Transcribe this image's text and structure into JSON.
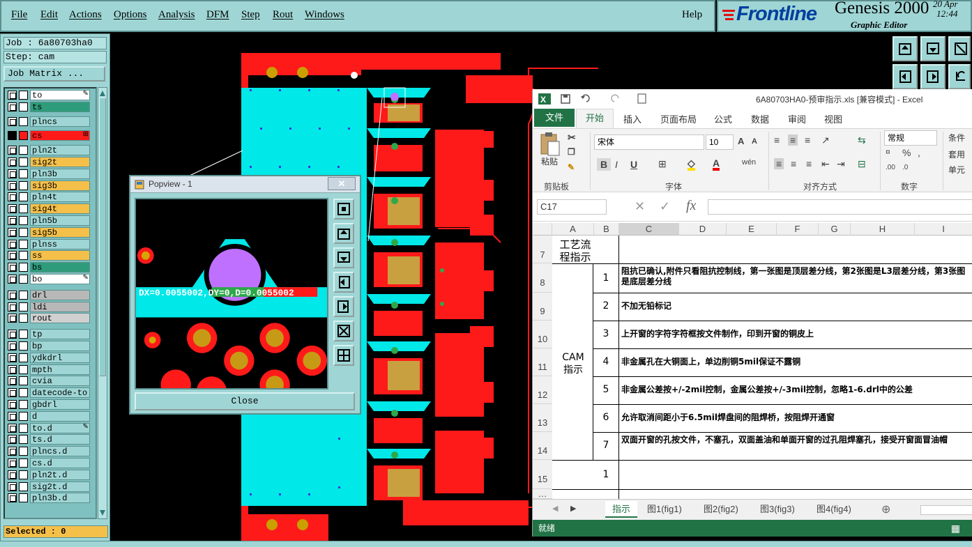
{
  "menu": {
    "items": [
      "File",
      "Edit",
      "Actions",
      "Options",
      "Analysis",
      "DFM",
      "Step",
      "Rout",
      "Windows"
    ],
    "help": "Help"
  },
  "brand": {
    "logo": "Frontline",
    "product": "Genesis 2000",
    "subtitle": "Graphic Editor",
    "date": "20 Apr",
    "time": "12:44"
  },
  "job": {
    "job_line": "Job : 6a80703ha0",
    "step_line": "Step: cam",
    "matrix_button": "Job Matrix ...",
    "selected": "Selected : 0"
  },
  "layers": [
    {
      "name": "to",
      "color": "#ffffff",
      "mark": "pen"
    },
    {
      "name": "ts",
      "color": "#2e9c7a"
    },
    {
      "name": "plncs",
      "color": "#9fd6d5"
    },
    {
      "name": "cs",
      "color": "#ff1a1a",
      "mark": "grid",
      "active": true
    },
    {
      "name": "pln2t",
      "color": "#9fd6d5"
    },
    {
      "name": "sig2t",
      "color": "#f5c04a"
    },
    {
      "name": "pln3b",
      "color": "#9fd6d5"
    },
    {
      "name": "sig3b",
      "color": "#f5c04a"
    },
    {
      "name": "pln4t",
      "color": "#9fd6d5"
    },
    {
      "name": "sig4t",
      "color": "#f5c04a"
    },
    {
      "name": "pln5b",
      "color": "#9fd6d5"
    },
    {
      "name": "sig5b",
      "color": "#f5c04a"
    },
    {
      "name": "plnss",
      "color": "#9fd6d5"
    },
    {
      "name": "ss",
      "color": "#f5c04a"
    },
    {
      "name": "bs",
      "color": "#2e9c7a"
    },
    {
      "name": "bo",
      "color": "#ffffff",
      "mark": "pen"
    },
    {
      "name": "drl",
      "color": "#b8b8b8"
    },
    {
      "name": "ldi",
      "color": "#b8b8b8"
    },
    {
      "name": "rout",
      "color": "#d0d0d0"
    },
    {
      "name": "tp",
      "color": "#9fd6d5"
    },
    {
      "name": "bp",
      "color": "#9fd6d5"
    },
    {
      "name": "ydkdrl",
      "color": "#9fd6d5"
    },
    {
      "name": "mpth",
      "color": "#9fd6d5"
    },
    {
      "name": "cvia",
      "color": "#9fd6d5"
    },
    {
      "name": "datecode-to",
      "color": "#9fd6d5"
    },
    {
      "name": "gbdrl",
      "color": "#9fd6d5"
    },
    {
      "name": "d",
      "color": "#9fd6d5"
    },
    {
      "name": "to.d",
      "color": "#9fd6d5",
      "mark": "pen"
    },
    {
      "name": "ts.d",
      "color": "#9fd6d5"
    },
    {
      "name": "plncs.d",
      "color": "#9fd6d5"
    },
    {
      "name": "cs.d",
      "color": "#9fd6d5"
    },
    {
      "name": "pln2t.d",
      "color": "#9fd6d5"
    },
    {
      "name": "sig2t.d",
      "color": "#9fd6d5"
    },
    {
      "name": "pln3b.d",
      "color": "#9fd6d5"
    }
  ],
  "popview": {
    "title": "Popview - 1",
    "close_x": "✕",
    "measure": "DX=0.0055002,DY=0,D=0.0055002",
    "close_button": "Close"
  },
  "excel": {
    "title": "6A80703HA0-预审指示.xls  [兼容模式] - Excel",
    "tabs": [
      "文件",
      "开始",
      "插入",
      "页面布局",
      "公式",
      "数据",
      "审阅",
      "视图"
    ],
    "clipboard": {
      "paste": "粘贴",
      "group": "剪贴板"
    },
    "font": {
      "name": "宋体",
      "size": "10",
      "group": "字体"
    },
    "align_group": "对齐方式",
    "number": {
      "format": "常规",
      "group": "数字"
    },
    "styles": [
      "条件",
      "套用",
      "单元"
    ],
    "namebox": "C17",
    "fx": "fx",
    "columns": [
      "A",
      "B",
      "C",
      "D",
      "E",
      "F",
      "G",
      "H",
      "I"
    ],
    "rows": [
      {
        "num": "7",
        "a": "工艺流程指示",
        "b": "",
        "c": ""
      },
      {
        "num": "8",
        "a": "",
        "b": "1",
        "c": "阻抗已确认,附件只看阻抗控制线，第一张图是顶层差分线，第2张图是L3层差分线，第3张图是底层差分线"
      },
      {
        "num": "9",
        "a": "",
        "b": "2",
        "c": "不加无铅标记"
      },
      {
        "num": "10",
        "a": "",
        "b": "3",
        "c": "上开窗的字符字符框按文件制作，印到开窗的铜皮上"
      },
      {
        "num": "11",
        "a": "CAM指示",
        "b": "4",
        "c": "非金属孔在大铜面上，单边削铜5mil保证不露铜"
      },
      {
        "num": "12",
        "a": "",
        "b": "5",
        "c": "非金属公差按+/-2mil控制，金属公差按+/-3mil控制，忽略1-6.drl中的公差"
      },
      {
        "num": "13",
        "a": "",
        "b": "6",
        "c": "允许取消间距小于6.5mil焊盘间的阻焊桥，按阻焊开通窗"
      },
      {
        "num": "14",
        "a": "",
        "b": "7",
        "c": "双面开窗的孔按文件，不塞孔，双面盖油和单面开窗的过孔阻焊塞孔，接受开窗面冒油帽"
      },
      {
        "num": "15",
        "a": "",
        "b": "1",
        "c": ""
      }
    ],
    "sheets": [
      "指示",
      "图1(fig1)",
      "图2(fig2)",
      "图3(fig3)",
      "图4(fig4)"
    ],
    "status": "就绪"
  }
}
